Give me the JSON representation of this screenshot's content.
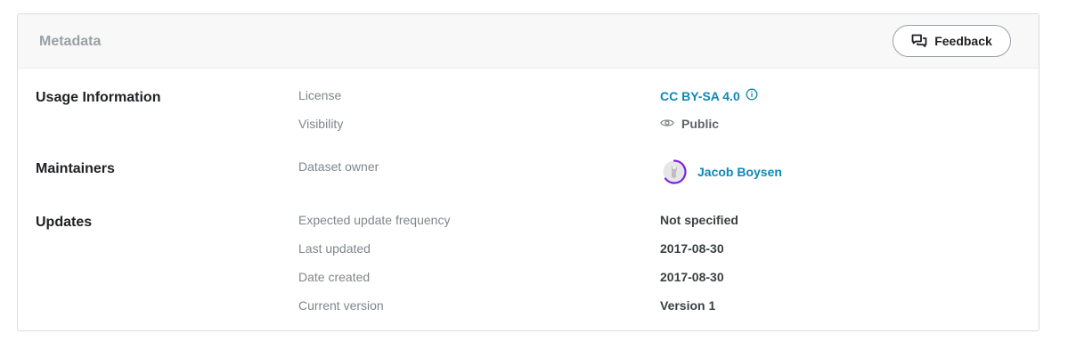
{
  "header": {
    "title": "Metadata",
    "feedback_label": "Feedback",
    "feedback_icon": "chat-bubbles-icon"
  },
  "sections": {
    "usage": {
      "title": "Usage Information",
      "license_label": "License",
      "license_value": "CC BY-SA 4.0",
      "license_icon": "info-icon",
      "visibility_label": "Visibility",
      "visibility_value": "Public",
      "visibility_icon": "eye-icon"
    },
    "maintainers": {
      "title": "Maintainers",
      "owner_label": "Dataset owner",
      "owner_name": "Jacob Boysen"
    },
    "updates": {
      "title": "Updates",
      "frequency_label": "Expected update frequency",
      "frequency_value": "Not specified",
      "last_updated_label": "Last updated",
      "last_updated_value": "2017-08-30",
      "date_created_label": "Date created",
      "date_created_value": "2017-08-30",
      "current_version_label": "Current version",
      "current_version_value": "Version 1"
    }
  },
  "colors": {
    "link": "#0d87b8",
    "avatar_ring": "#7b1fe0"
  }
}
